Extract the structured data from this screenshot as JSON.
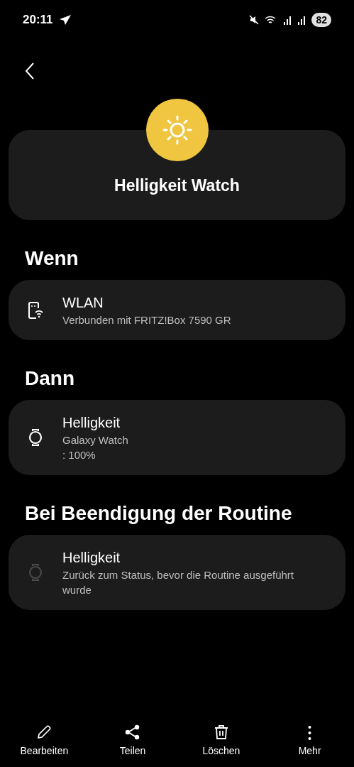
{
  "status_bar": {
    "time": "20:11",
    "battery": "82"
  },
  "routine": {
    "title": "Helligkeit Watch"
  },
  "sections": [
    {
      "heading": "Wenn",
      "items": [
        {
          "kind": "wifi",
          "title": "WLAN",
          "lines": [
            "Verbunden mit FRITZ!Box 7590 GR"
          ],
          "dimmed": false
        }
      ]
    },
    {
      "heading": "Dann",
      "items": [
        {
          "kind": "watch",
          "title": "Helligkeit",
          "lines": [
            "Galaxy Watch",
            ": 100%"
          ],
          "dimmed": false
        }
      ]
    },
    {
      "heading": "Bei Beendigung der Routine",
      "items": [
        {
          "kind": "watch",
          "title": "Helligkeit",
          "lines": [
            "Zurück zum Status, bevor die Routine ausgeführt wurde"
          ],
          "dimmed": true
        }
      ]
    }
  ],
  "bottom_bar": [
    {
      "kind": "edit",
      "label": "Bearbeiten"
    },
    {
      "kind": "share",
      "label": "Teilen"
    },
    {
      "kind": "delete",
      "label": "Löschen"
    },
    {
      "kind": "more",
      "label": "Mehr"
    }
  ]
}
